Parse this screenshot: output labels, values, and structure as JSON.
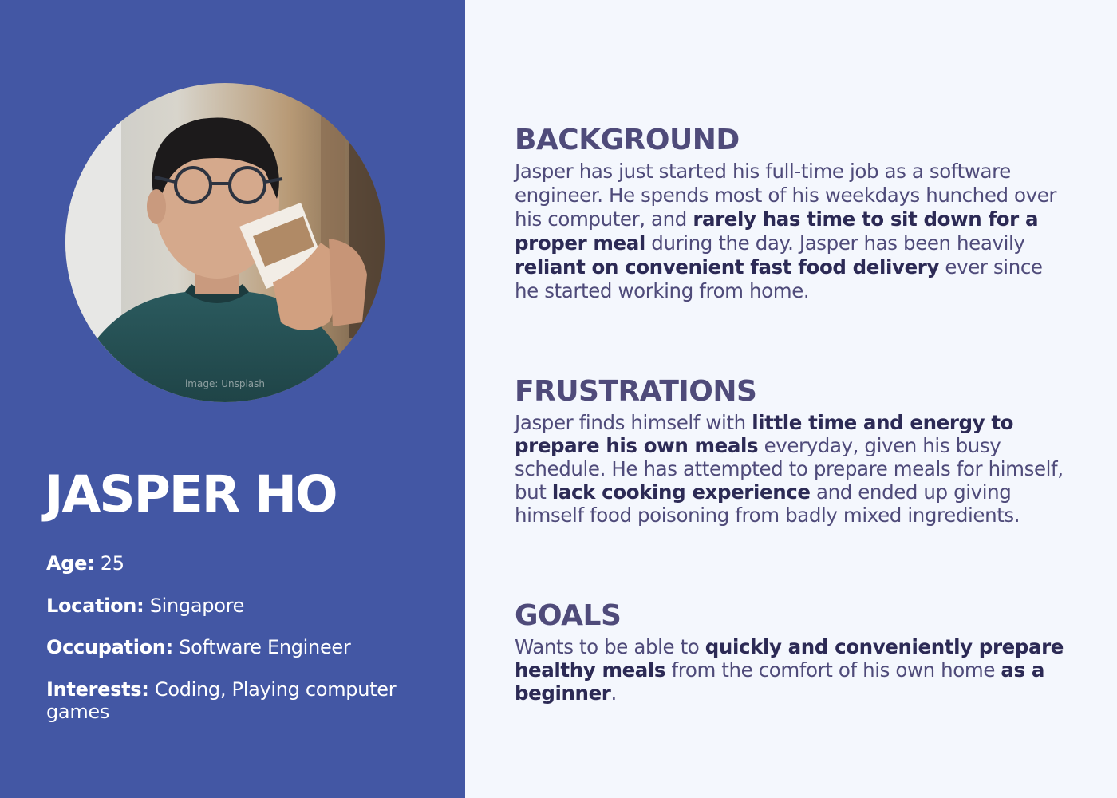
{
  "persona": {
    "name": "JASPER HO",
    "photo_credit": "image: Unsplash",
    "attributes": [
      {
        "key": "Age:",
        "value": "25"
      },
      {
        "key": "Location:",
        "value": "Singapore"
      },
      {
        "key": "Occupation:",
        "value": "Software Engineer"
      },
      {
        "key": "Interests:",
        "value": "Coding, Playing computer games"
      }
    ]
  },
  "sections": {
    "background": {
      "title": "BACKGROUND",
      "segments": [
        {
          "t": "Jasper has just started his full-time job as a software engineer. He spends most of his weekdays hunched over his computer, and "
        },
        {
          "t": "rarely has time to sit down for a proper meal",
          "b": true
        },
        {
          "t": " during the day. Jasper has been heavily "
        },
        {
          "t": "reliant on convenient fast food delivery",
          "b": true
        },
        {
          "t": " ever since he started working from home."
        }
      ]
    },
    "frustrations": {
      "title": "FRUSTRATIONS",
      "segments": [
        {
          "t": "Jasper finds himself with "
        },
        {
          "t": "little time and energy to prepare his own meals",
          "b": true
        },
        {
          "t": " everyday, given his busy schedule. He has attempted to prepare meals for himself, but "
        },
        {
          "t": "lack cooking experience",
          "b": true
        },
        {
          "t": " and ended up giving himself food poisoning from badly mixed ingredients."
        }
      ]
    },
    "goals": {
      "title": "GOALS",
      "segments": [
        {
          "t": "Wants to be able to "
        },
        {
          "t": "quickly and conveniently prepare healthy meals",
          "b": true
        },
        {
          "t": " from the comfort of his own home "
        },
        {
          "t": "as a beginner",
          "b": true
        },
        {
          "t": "."
        }
      ]
    }
  },
  "colors": {
    "panel": "#4357a4",
    "page": "#f4f7fd",
    "heading": "#4f4b7a",
    "emphasis": "#2c2a55"
  }
}
